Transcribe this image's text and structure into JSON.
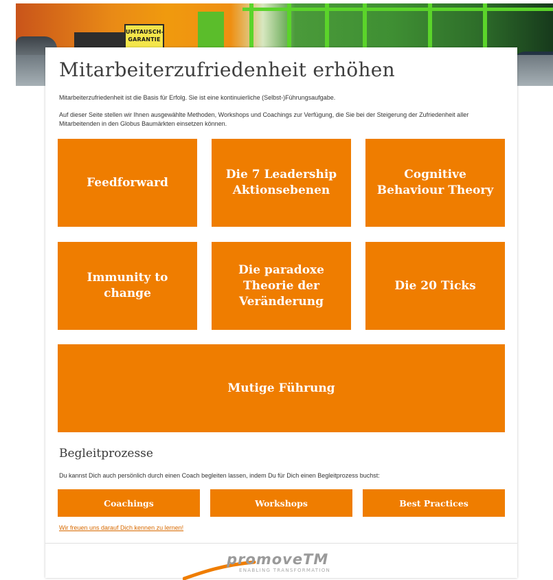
{
  "banner": {
    "sign_line1": "UMTAUSCH-",
    "sign_line2": "GARANTIE"
  },
  "page": {
    "title": "Mitarbeiterzufriedenheit erhöhen",
    "intro_1": "Mitarbeiterzufriedenheit ist die Basis für Erfolg. Sie ist eine kontinuierliche (Selbst-)Führungsaufgabe.",
    "intro_2": "Auf dieser Seite stellen wir Ihnen ausgewählte Methoden, Workshops und Coachings zur Verfügung, die Sie bei der Steigerung der Zufriedenheit aller Mitarbeitenden in den Globus Baumärkten einsetzen können."
  },
  "tiles": [
    {
      "label": "Feedforward"
    },
    {
      "label": "Die 7 Leadership Aktionsebenen"
    },
    {
      "label": "Cognitive Behaviour Theory"
    },
    {
      "label": "Immunity to change"
    },
    {
      "label": "Die paradoxe Theorie der Veränderung"
    },
    {
      "label": "Die 20 Ticks"
    },
    {
      "label": "Mutige Führung"
    }
  ],
  "begleit": {
    "heading": "Begleitprozesse",
    "text": "Du kannst Dich auch persönlich durch einen Coach begleiten lassen, indem Du für Dich einen Begleitprozess buchst:",
    "buttons": [
      {
        "label": "Coachings"
      },
      {
        "label": "Workshops"
      },
      {
        "label": "Best Practices"
      }
    ],
    "link": "Wir freuen uns darauf Dich kennen zu lernen!"
  },
  "footer": {
    "logo_word": "promoveTM",
    "logo_tag": "ENABLING TRANSFORMATION"
  },
  "colors": {
    "accent": "#ef7d00",
    "title_text": "#3e3e3e",
    "link": "#d86a00"
  }
}
